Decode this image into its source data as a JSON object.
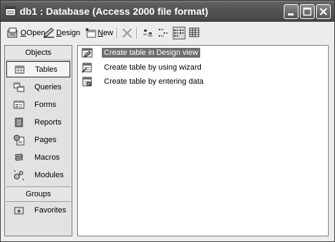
{
  "window": {
    "title": "db1 : Database (Access 2000 file format)"
  },
  "toolbar": {
    "open_label": "Open",
    "open_key": "O",
    "design_label": "esign",
    "design_key": "D",
    "new_label": "ew",
    "new_key": "N"
  },
  "sidebar": {
    "objects_header": "Objects",
    "groups_header": "Groups",
    "items": [
      {
        "label": "Tables",
        "icon": "table-icon"
      },
      {
        "label": "Queries",
        "icon": "query-icon"
      },
      {
        "label": "Forms",
        "icon": "form-icon"
      },
      {
        "label": "Reports",
        "icon": "report-icon"
      },
      {
        "label": "Pages",
        "icon": "page-icon"
      },
      {
        "label": "Macros",
        "icon": "macro-icon"
      },
      {
        "label": "Modules",
        "icon": "module-icon"
      }
    ],
    "favorites": "Favorites",
    "selected": "Tables"
  },
  "content": {
    "items": [
      {
        "label": "Create table in Design view"
      },
      {
        "label": "Create table by using wizard"
      },
      {
        "label": "Create table by entering data"
      }
    ],
    "selected_index": 0
  },
  "colors": {
    "titlebar": "#515151",
    "selection": "#6e6e6e"
  }
}
